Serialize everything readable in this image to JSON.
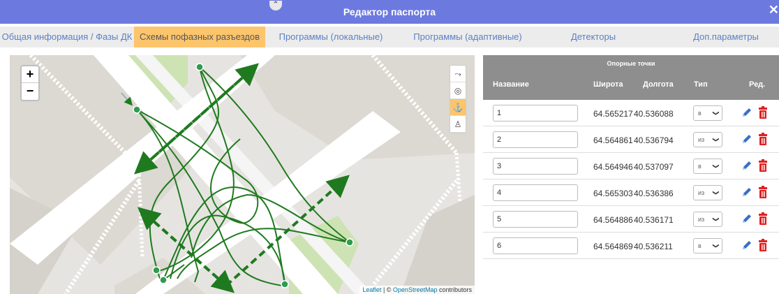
{
  "window": {
    "title": "Редактор паспорта",
    "collapse_icon": "chevron-up-icon",
    "close_icon": "close-icon"
  },
  "tabs": [
    {
      "label": "Общая информация / Фазы ДК",
      "active": false
    },
    {
      "label": "Схемы пофазных разъездов",
      "active": true
    },
    {
      "label": "Программы (локальные)",
      "active": false
    },
    {
      "label": "Программы (адаптивные)",
      "active": false
    },
    {
      "label": "Детекторы",
      "active": false
    },
    {
      "label": "Доп.параметры",
      "active": false
    }
  ],
  "map": {
    "zoom_in": "+",
    "zoom_out": "−",
    "tools": [
      "route-draw-icon",
      "marker-icon",
      "anchor-icon",
      "pedestrian-icon"
    ],
    "active_tool": "anchor-icon",
    "attribution": {
      "leaflet": "Leaflet",
      "sep": " | © ",
      "osm": "OpenStreetMap",
      "rest": " contributors"
    },
    "route_color": "#1f7a1f"
  },
  "points_table": {
    "caption": "Опорные точки",
    "headers": {
      "name": "Название",
      "lat": "Широта",
      "lng": "Долгота",
      "type": "Тип",
      "edit": "Ред."
    },
    "rows": [
      {
        "name": "1",
        "lat": "64.565217",
        "lng": "40.536088",
        "type": "в"
      },
      {
        "name": "2",
        "lat": "64.564861",
        "lng": "40.536794",
        "type": "из"
      },
      {
        "name": "3",
        "lat": "64.564946",
        "lng": "40.537097",
        "type": "в"
      },
      {
        "name": "4",
        "lat": "64.565303",
        "lng": "40.536386",
        "type": "из"
      },
      {
        "name": "5",
        "lat": "64.564886",
        "lng": "40.536171",
        "type": "из"
      },
      {
        "name": "6",
        "lat": "64.564869",
        "lng": "40.536211",
        "type": "в"
      }
    ]
  },
  "colors": {
    "header": "#6c7ae0",
    "active_tab": "#fcc56c",
    "edit": "#3b6fc6",
    "delete": "#e02020"
  }
}
